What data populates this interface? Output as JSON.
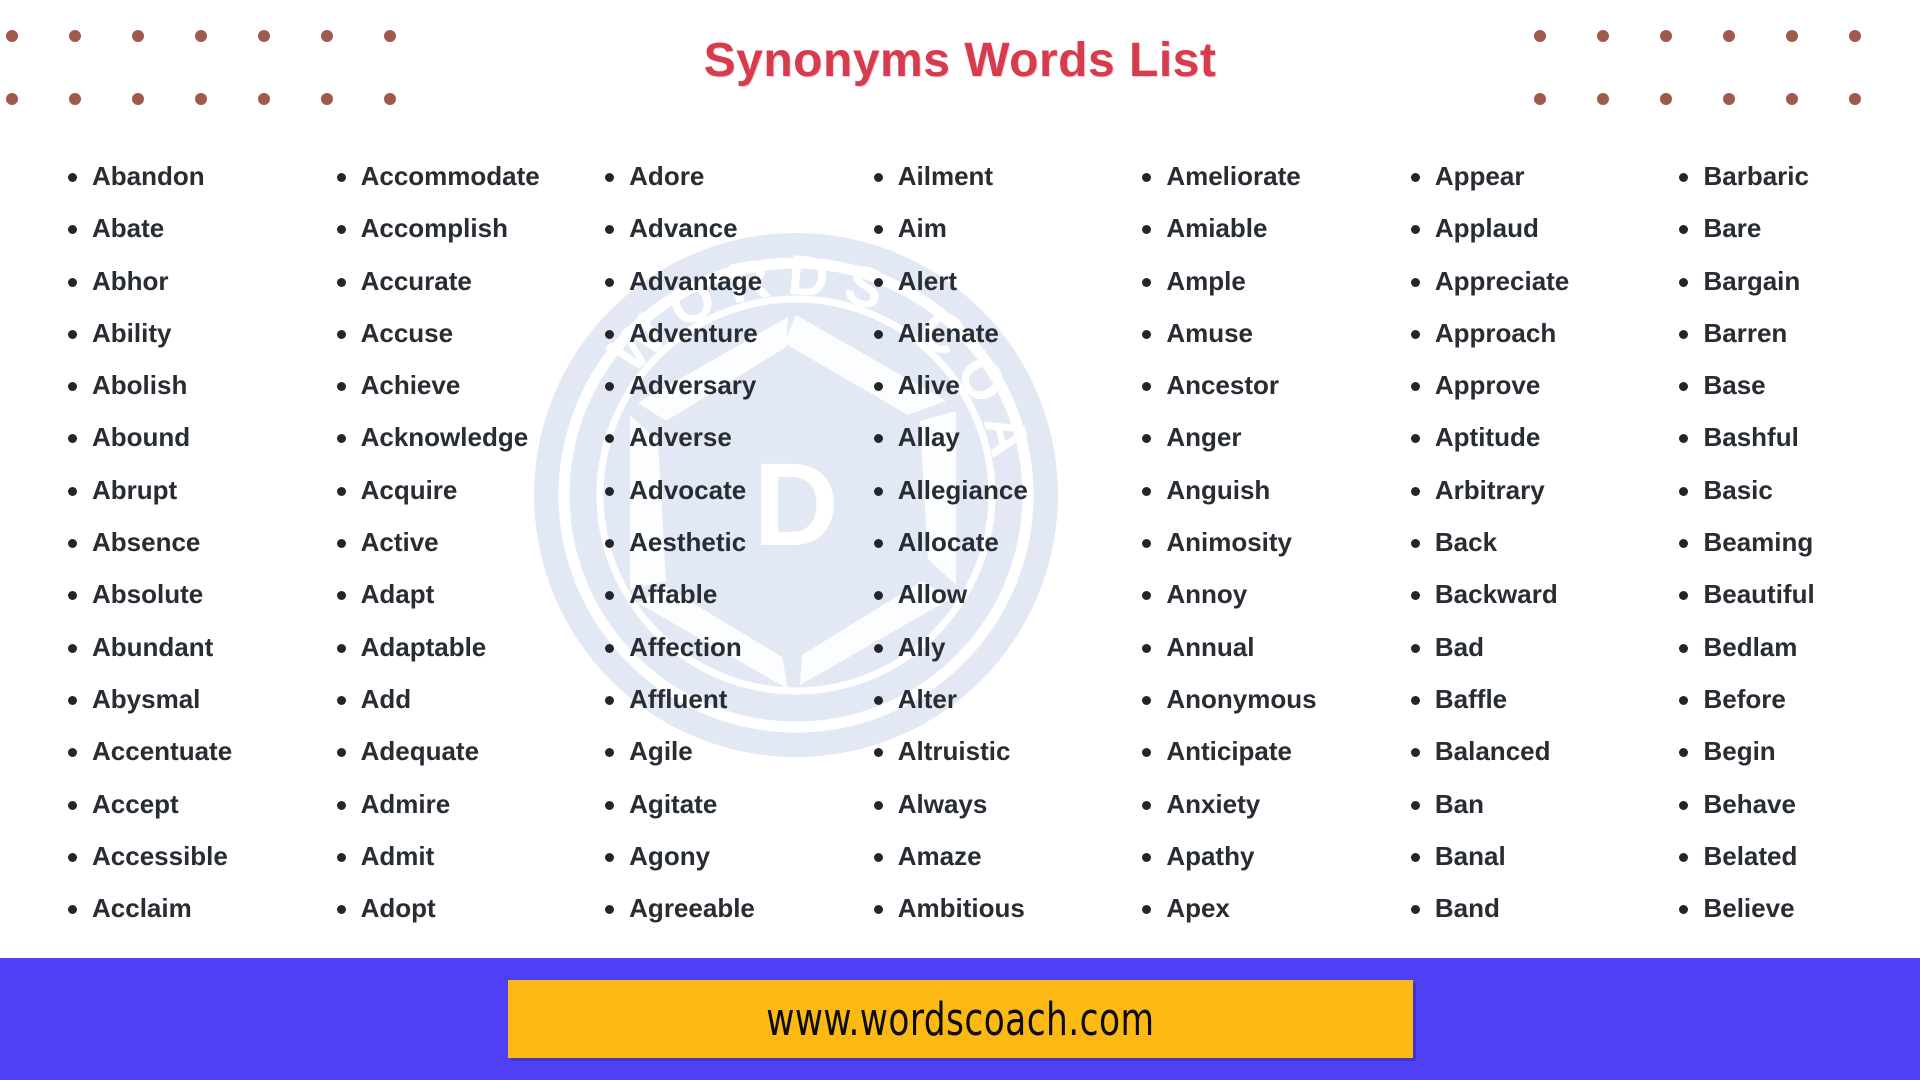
{
  "header": {
    "title": "Synonyms Words List",
    "title_color": "#d63c4e",
    "dot_color": "#a05a4c",
    "left_dot_columns": 7,
    "right_dot_columns": 6,
    "dot_rows": 2
  },
  "watermark": {
    "text_top": "WORDS COACH",
    "brand_letter": "D",
    "color": "#e3e9f4"
  },
  "columns": [
    {
      "index": 1,
      "words": [
        "Abandon",
        "Abate",
        "Abhor",
        "Ability",
        "Abolish",
        "Abound",
        "Abrupt",
        "Absence",
        "Absolute",
        "Abundant",
        "Abysmal",
        "Accentuate",
        "Accept",
        "Accessible",
        "Acclaim"
      ]
    },
    {
      "index": 2,
      "words": [
        "Accommodate",
        "Accomplish",
        "Accurate",
        "Accuse",
        "Achieve",
        "Acknowledge",
        "Acquire",
        "Active",
        "Adapt",
        "Adaptable",
        "Add",
        "Adequate",
        "Admire",
        "Admit",
        "Adopt"
      ]
    },
    {
      "index": 3,
      "words": [
        "Adore",
        "Advance",
        "Advantage",
        "Adventure",
        "Adversary",
        "Adverse",
        "Advocate",
        "Aesthetic",
        "Affable",
        "Affection",
        "Affluent",
        "Agile",
        "Agitate",
        "Agony",
        "Agreeable"
      ]
    },
    {
      "index": 4,
      "words": [
        "Ailment",
        "Aim",
        "Alert",
        "Alienate",
        "Alive",
        "Allay",
        "Allegiance",
        "Allocate",
        "Allow",
        "Ally",
        "Alter",
        "Altruistic",
        "Always",
        "Amaze",
        "Ambitious"
      ]
    },
    {
      "index": 5,
      "words": [
        "Ameliorate",
        "Amiable",
        "Ample",
        "Amuse",
        "Ancestor",
        "Anger",
        "Anguish",
        "Animosity",
        "Annoy",
        "Annual",
        "Anonymous",
        "Anticipate",
        "Anxiety",
        "Apathy",
        "Apex"
      ]
    },
    {
      "index": 6,
      "words": [
        "Appear",
        "Applaud",
        "Appreciate",
        "Approach",
        "Approve",
        "Aptitude",
        "Arbitrary",
        "Back",
        "Backward",
        "Bad",
        "Baffle",
        "Balanced",
        "Ban",
        "Banal",
        "Band"
      ]
    },
    {
      "index": 7,
      "words": [
        "Barbaric",
        "Bare",
        "Bargain",
        "Barren",
        "Base",
        "Bashful",
        "Basic",
        "Beaming",
        "Beautiful",
        "Bedlam",
        "Before",
        "Begin",
        "Behave",
        "Belated",
        "Believe"
      ]
    }
  ],
  "footer": {
    "url": "www.wordscoach.com",
    "bar_color": "#5040f5",
    "badge_color": "#fcb913",
    "url_color": "#0c0c0c"
  }
}
